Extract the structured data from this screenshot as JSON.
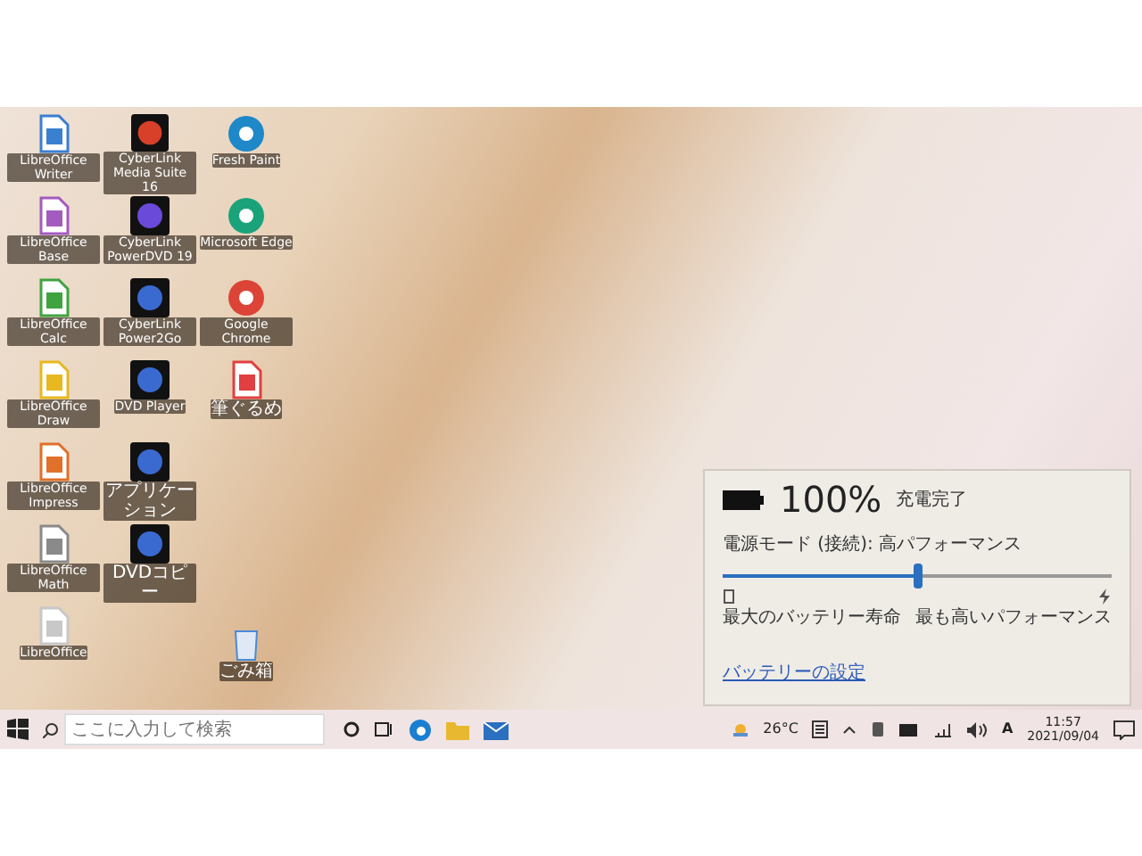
{
  "desktop": {
    "columns": [
      [
        {
          "label": "LibreOffice Writer",
          "kind": "document",
          "color": "#3a7fd0"
        },
        {
          "label": "LibreOffice Base",
          "kind": "document",
          "color": "#a35bbf"
        },
        {
          "label": "LibreOffice Calc",
          "kind": "document",
          "color": "#3fa33f"
        },
        {
          "label": "LibreOffice Draw",
          "kind": "document",
          "color": "#e8b820"
        },
        {
          "label": "LibreOffice Impress",
          "kind": "document",
          "color": "#e0702a"
        },
        {
          "label": "LibreOffice Math",
          "kind": "document",
          "color": "#8a8a8a"
        },
        {
          "label": "LibreOffice",
          "kind": "document",
          "color": "#c8c8c8"
        }
      ],
      [
        {
          "label": "CyberLink Media Suite 16",
          "kind": "app",
          "color": "#d8402a"
        },
        {
          "label": "CyberLink PowerDVD 19",
          "kind": "app",
          "color": "#6a4ad8"
        },
        {
          "label": "CyberLink Power2Go",
          "kind": "app",
          "color": "#3a6ad0"
        },
        {
          "label": "DVD Player",
          "kind": "app",
          "color": "#3a6ad0"
        },
        {
          "label": "アプリケーション",
          "kind": "app",
          "color": "#3a6ad0"
        },
        {
          "label": "DVDコピー",
          "kind": "app",
          "color": "#3a6ad0"
        }
      ],
      [
        {
          "label": "Fresh Paint",
          "kind": "circle",
          "color": "#1e88c8"
        },
        {
          "label": "Microsoft Edge",
          "kind": "circle",
          "color": "#1aa37a"
        },
        {
          "label": "Google Chrome",
          "kind": "circle",
          "color": "#db4437"
        },
        {
          "label": "筆ぐるめ",
          "kind": "document",
          "color": "#e04040"
        },
        {
          "label": "ごみ箱",
          "kind": "bin",
          "color": "#4a8ad8"
        }
      ]
    ]
  },
  "battery_flyout": {
    "percent": "100%",
    "status": "充電完了",
    "mode_label": "電源モード (接続): 高パフォーマンス",
    "slider": {
      "level": 0.5
    },
    "left_label": "最大のバッテリー寿命",
    "right_label": "最も高いパフォーマンス",
    "settings_link": "バッテリーの設定"
  },
  "taskbar": {
    "search": {
      "placeholder": "ここに入力して検索"
    },
    "temperature": "26°C",
    "ime": "A",
    "time": "11:57",
    "date": "2021/09/04"
  }
}
